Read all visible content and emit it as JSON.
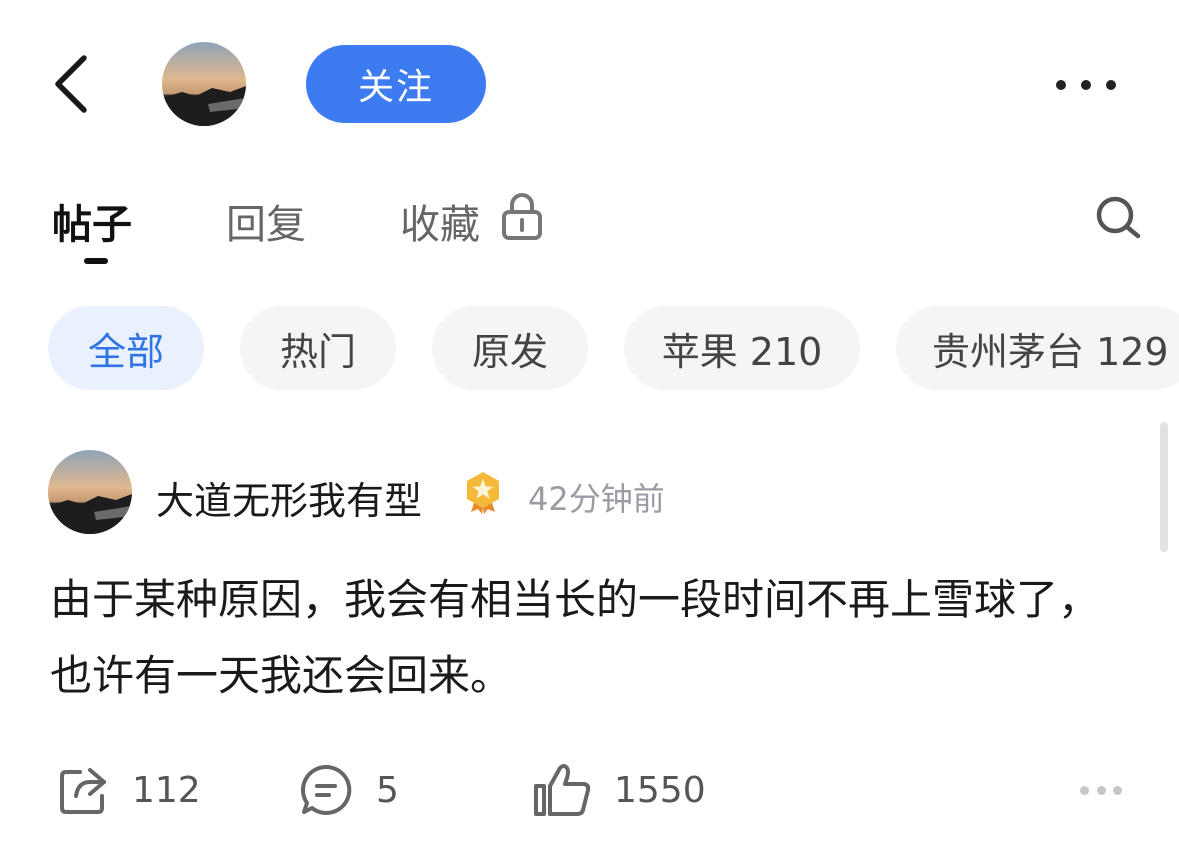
{
  "header": {
    "follow_label": "关注",
    "accent_color": "#3d7cf0"
  },
  "tabs": [
    {
      "label": "帖子",
      "active": true
    },
    {
      "label": "回复",
      "active": false
    },
    {
      "label": "收藏",
      "active": false,
      "icon": "lock-icon"
    }
  ],
  "filters": [
    {
      "label": "全部",
      "active": true
    },
    {
      "label": "热门",
      "active": false
    },
    {
      "label": "原发",
      "active": false
    },
    {
      "label": "苹果 210",
      "active": false
    },
    {
      "label": "贵州茅台 129",
      "active": false
    }
  ],
  "post": {
    "author": "大道无形我有型",
    "badge_icon": "gold-star-badge-icon",
    "time": "42分钟前",
    "body": "由于某种原因，我会有相当长的一段时间不再上雪球了，也许有一天我还会回来。",
    "actions": {
      "share_count": "112",
      "comment_count": "5",
      "like_count": "1550"
    }
  },
  "icons": {
    "back": "chevron-left-icon",
    "more": "more-horizontal-icon",
    "search": "search-icon",
    "share": "share-icon",
    "comment": "comment-icon",
    "like": "thumbs-up-icon"
  }
}
